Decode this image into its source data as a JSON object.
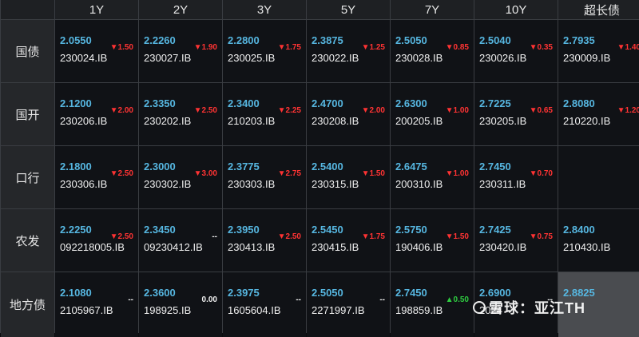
{
  "columns": [
    "1Y",
    "2Y",
    "3Y",
    "5Y",
    "7Y",
    "10Y",
    "超长债"
  ],
  "rows": [
    {
      "label": "国债",
      "cells": [
        {
          "yield": "2.0550",
          "change": "▼1.50",
          "dir": "down",
          "code": "230024.IB"
        },
        {
          "yield": "2.2260",
          "change": "▼1.90",
          "dir": "down",
          "code": "230027.IB"
        },
        {
          "yield": "2.2800",
          "change": "▼1.75",
          "dir": "down",
          "code": "230025.IB"
        },
        {
          "yield": "2.3875",
          "change": "▼1.25",
          "dir": "down",
          "code": "230022.IB"
        },
        {
          "yield": "2.5050",
          "change": "▼0.85",
          "dir": "down",
          "code": "230028.IB"
        },
        {
          "yield": "2.5040",
          "change": "▼0.35",
          "dir": "down",
          "code": "230026.IB"
        },
        {
          "yield": "2.7935",
          "change": "▼1.40",
          "dir": "down",
          "code": "230009.IB"
        }
      ]
    },
    {
      "label": "国开",
      "cells": [
        {
          "yield": "2.1200",
          "change": "▼2.00",
          "dir": "down",
          "code": "230206.IB"
        },
        {
          "yield": "2.3350",
          "change": "▼2.50",
          "dir": "down",
          "code": "230202.IB"
        },
        {
          "yield": "2.3400",
          "change": "▼2.25",
          "dir": "down",
          "code": "210203.IB"
        },
        {
          "yield": "2.4700",
          "change": "▼2.00",
          "dir": "down",
          "code": "230208.IB"
        },
        {
          "yield": "2.6300",
          "change": "▼1.00",
          "dir": "down",
          "code": "200205.IB"
        },
        {
          "yield": "2.7225",
          "change": "▼0.65",
          "dir": "down",
          "code": "230205.IB"
        },
        {
          "yield": "2.8080",
          "change": "▼1.20",
          "dir": "down",
          "code": "210220.IB"
        }
      ]
    },
    {
      "label": "口行",
      "cells": [
        {
          "yield": "2.1800",
          "change": "▼2.50",
          "dir": "down",
          "code": "230306.IB"
        },
        {
          "yield": "2.3000",
          "change": "▼3.00",
          "dir": "down",
          "code": "230302.IB"
        },
        {
          "yield": "2.3775",
          "change": "▼2.75",
          "dir": "down",
          "code": "230303.IB"
        },
        {
          "yield": "2.5400",
          "change": "▼1.50",
          "dir": "down",
          "code": "230315.IB"
        },
        {
          "yield": "2.6475",
          "change": "▼1.00",
          "dir": "down",
          "code": "200310.IB"
        },
        {
          "yield": "2.7450",
          "change": "▼0.70",
          "dir": "down",
          "code": "230311.IB"
        },
        {
          "yield": "",
          "change": "",
          "dir": "flat",
          "code": ""
        }
      ]
    },
    {
      "label": "农发",
      "cells": [
        {
          "yield": "2.2250",
          "change": "▼2.50",
          "dir": "down",
          "code": "092218005.IB"
        },
        {
          "yield": "2.3450",
          "change": "--",
          "dir": "flat",
          "code": "09230412.IB"
        },
        {
          "yield": "2.3950",
          "change": "▼2.50",
          "dir": "down",
          "code": "230413.IB"
        },
        {
          "yield": "2.5450",
          "change": "▼1.75",
          "dir": "down",
          "code": "230415.IB"
        },
        {
          "yield": "2.5750",
          "change": "▼1.50",
          "dir": "down",
          "code": "190406.IB"
        },
        {
          "yield": "2.7425",
          "change": "▼0.75",
          "dir": "down",
          "code": "230420.IB"
        },
        {
          "yield": "2.8400",
          "change": "",
          "dir": "flat",
          "code": "210430.IB"
        }
      ]
    },
    {
      "label": "地方债",
      "cells": [
        {
          "yield": "2.1080",
          "change": "--",
          "dir": "flat",
          "code": "2105967.IB"
        },
        {
          "yield": "2.3600",
          "change": "0.00",
          "dir": "flat",
          "code": "198925.IB"
        },
        {
          "yield": "2.3975",
          "change": "--",
          "dir": "flat",
          "code": "1605604.IB"
        },
        {
          "yield": "2.5050",
          "change": "--",
          "dir": "flat",
          "code": "2271997.IB"
        },
        {
          "yield": "2.7450",
          "change": "▲0.50",
          "dir": "up",
          "code": "198859.IB"
        },
        {
          "yield": "2.6900",
          "change": "--",
          "dir": "flat",
          "code": "2024"
        },
        {
          "yield": "2.8825",
          "change": "",
          "dir": "flat",
          "code": "",
          "highlight": true
        }
      ]
    }
  ],
  "watermark": "雪球：亚江TH",
  "colors": {
    "yield": "#56b6e0",
    "down": "#ff3333",
    "up": "#2ecc40",
    "text": "#f0f0f0"
  }
}
